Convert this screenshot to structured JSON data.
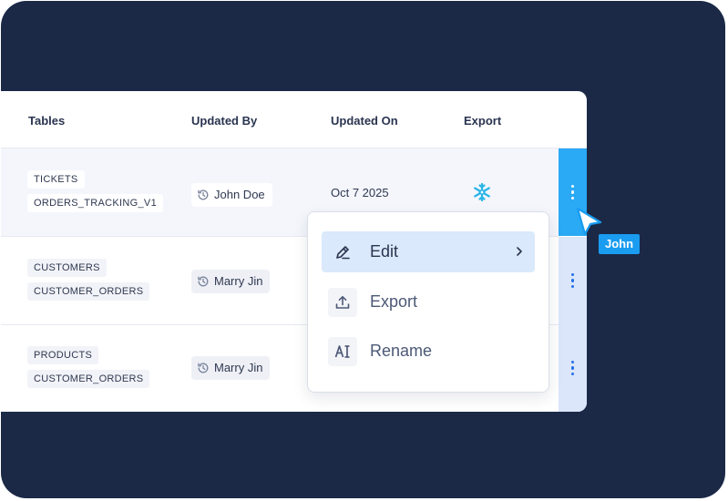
{
  "table": {
    "headers": [
      "Tables",
      "Updated By",
      "Updated On",
      "Export"
    ],
    "rows": [
      {
        "tables": [
          "TICKETS",
          "ORDERS_TRACKING_V1"
        ],
        "updated_by": "John Doe",
        "updated_on": "Oct 7 2025",
        "export_icon": "snowflake-icon",
        "selected": true
      },
      {
        "tables": [
          "CUSTOMERS",
          "CUSTOMER_ORDERS"
        ],
        "updated_by": "Marry Jin",
        "updated_on": "",
        "export_icon": "",
        "selected": false
      },
      {
        "tables": [
          "PRODUCTS",
          "CUSTOMER_ORDERS"
        ],
        "updated_by": "Marry Jin",
        "updated_on": "",
        "export_icon": "",
        "selected": false
      }
    ]
  },
  "context_menu": {
    "items": [
      {
        "label": "Edit",
        "icon": "pencil-icon",
        "active": true,
        "submenu": true
      },
      {
        "label": "Export",
        "icon": "upload-icon",
        "active": false
      },
      {
        "label": "Rename",
        "icon": "ai-rename-icon",
        "active": false
      }
    ]
  },
  "cursor": {
    "user": "John"
  },
  "colors": {
    "background": "#1b2947",
    "accent": "#2aa9f5",
    "cursor_tag": "#1a9cf0",
    "snowflake": "#29b5e8",
    "menu_active": "#dae9fb"
  }
}
